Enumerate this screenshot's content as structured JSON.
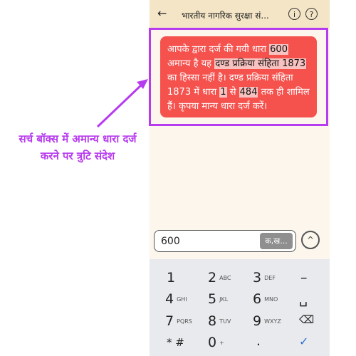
{
  "app": {
    "back_icon": "←",
    "title": "भारतीय नागरिक सुरक्षा सं...",
    "info_icon": "i",
    "help_icon": "?"
  },
  "error": {
    "p1": "आपके द्वारा दर्ज की गयी धारा ",
    "num": "600",
    "p2": " अमान्य है यह ",
    "act": "दण्ड प्रक्रिया संहिता 1873",
    "p3": " का हिस्सा नहीं है। दण्ड प्रक्रिया संहिता 1873 में धारा ",
    "r1": "1",
    "p4": " से ",
    "r2": "484",
    "p5": " तक ही शामिल हैं। कृपया मान्य धारा दर्ज करें।"
  },
  "search": {
    "value": "600",
    "script_label": "क,ख...",
    "submit_icon": "^"
  },
  "annotation": "सर्च बॉक्स में अमान्य धारा दर्ज करने पर त्रुटि संदेश",
  "colors": {
    "accent": "#b73bef",
    "error_bg": "#f5524e"
  },
  "keyboard": {
    "k1": "1",
    "k2": "2",
    "k2s": "ABC",
    "k3": "3",
    "k3s": "DEF",
    "kdash": "–",
    "k4": "4",
    "k4s": "GHI",
    "k5": "5",
    "k5s": "JKL",
    "k6": "6",
    "k6s": "MNO",
    "kspace": "␣",
    "k7": "7",
    "k7s": "PQRS",
    "k8": "8",
    "k8s": "TUV",
    "k9": "9",
    "k9s": "WXYZ",
    "kdel": "⌫",
    "kstar": "* #",
    "k0": "0",
    "k0s": "+",
    "kdot": ".",
    "kdone": "✓"
  }
}
